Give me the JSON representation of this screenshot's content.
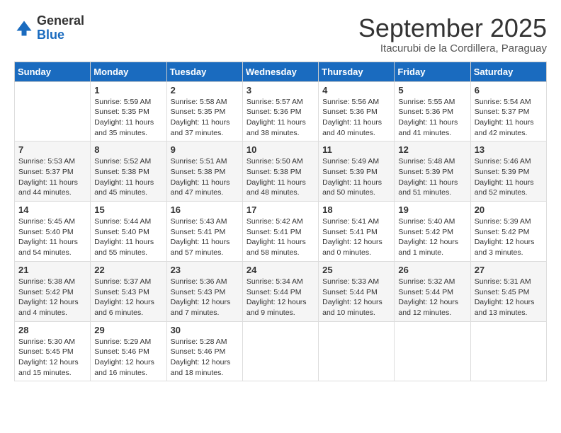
{
  "header": {
    "logo_general": "General",
    "logo_blue": "Blue",
    "month_title": "September 2025",
    "location": "Itacurubi de la Cordillera, Paraguay"
  },
  "days_of_week": [
    "Sunday",
    "Monday",
    "Tuesday",
    "Wednesday",
    "Thursday",
    "Friday",
    "Saturday"
  ],
  "weeks": [
    [
      {
        "day": "",
        "sunrise": "",
        "sunset": "",
        "daylight": ""
      },
      {
        "day": "1",
        "sunrise": "Sunrise: 5:59 AM",
        "sunset": "Sunset: 5:35 PM",
        "daylight": "Daylight: 11 hours and 35 minutes."
      },
      {
        "day": "2",
        "sunrise": "Sunrise: 5:58 AM",
        "sunset": "Sunset: 5:35 PM",
        "daylight": "Daylight: 11 hours and 37 minutes."
      },
      {
        "day": "3",
        "sunrise": "Sunrise: 5:57 AM",
        "sunset": "Sunset: 5:36 PM",
        "daylight": "Daylight: 11 hours and 38 minutes."
      },
      {
        "day": "4",
        "sunrise": "Sunrise: 5:56 AM",
        "sunset": "Sunset: 5:36 PM",
        "daylight": "Daylight: 11 hours and 40 minutes."
      },
      {
        "day": "5",
        "sunrise": "Sunrise: 5:55 AM",
        "sunset": "Sunset: 5:36 PM",
        "daylight": "Daylight: 11 hours and 41 minutes."
      },
      {
        "day": "6",
        "sunrise": "Sunrise: 5:54 AM",
        "sunset": "Sunset: 5:37 PM",
        "daylight": "Daylight: 11 hours and 42 minutes."
      }
    ],
    [
      {
        "day": "7",
        "sunrise": "Sunrise: 5:53 AM",
        "sunset": "Sunset: 5:37 PM",
        "daylight": "Daylight: 11 hours and 44 minutes."
      },
      {
        "day": "8",
        "sunrise": "Sunrise: 5:52 AM",
        "sunset": "Sunset: 5:38 PM",
        "daylight": "Daylight: 11 hours and 45 minutes."
      },
      {
        "day": "9",
        "sunrise": "Sunrise: 5:51 AM",
        "sunset": "Sunset: 5:38 PM",
        "daylight": "Daylight: 11 hours and 47 minutes."
      },
      {
        "day": "10",
        "sunrise": "Sunrise: 5:50 AM",
        "sunset": "Sunset: 5:38 PM",
        "daylight": "Daylight: 11 hours and 48 minutes."
      },
      {
        "day": "11",
        "sunrise": "Sunrise: 5:49 AM",
        "sunset": "Sunset: 5:39 PM",
        "daylight": "Daylight: 11 hours and 50 minutes."
      },
      {
        "day": "12",
        "sunrise": "Sunrise: 5:48 AM",
        "sunset": "Sunset: 5:39 PM",
        "daylight": "Daylight: 11 hours and 51 minutes."
      },
      {
        "day": "13",
        "sunrise": "Sunrise: 5:46 AM",
        "sunset": "Sunset: 5:39 PM",
        "daylight": "Daylight: 11 hours and 52 minutes."
      }
    ],
    [
      {
        "day": "14",
        "sunrise": "Sunrise: 5:45 AM",
        "sunset": "Sunset: 5:40 PM",
        "daylight": "Daylight: 11 hours and 54 minutes."
      },
      {
        "day": "15",
        "sunrise": "Sunrise: 5:44 AM",
        "sunset": "Sunset: 5:40 PM",
        "daylight": "Daylight: 11 hours and 55 minutes."
      },
      {
        "day": "16",
        "sunrise": "Sunrise: 5:43 AM",
        "sunset": "Sunset: 5:41 PM",
        "daylight": "Daylight: 11 hours and 57 minutes."
      },
      {
        "day": "17",
        "sunrise": "Sunrise: 5:42 AM",
        "sunset": "Sunset: 5:41 PM",
        "daylight": "Daylight: 11 hours and 58 minutes."
      },
      {
        "day": "18",
        "sunrise": "Sunrise: 5:41 AM",
        "sunset": "Sunset: 5:41 PM",
        "daylight": "Daylight: 12 hours and 0 minutes."
      },
      {
        "day": "19",
        "sunrise": "Sunrise: 5:40 AM",
        "sunset": "Sunset: 5:42 PM",
        "daylight": "Daylight: 12 hours and 1 minute."
      },
      {
        "day": "20",
        "sunrise": "Sunrise: 5:39 AM",
        "sunset": "Sunset: 5:42 PM",
        "daylight": "Daylight: 12 hours and 3 minutes."
      }
    ],
    [
      {
        "day": "21",
        "sunrise": "Sunrise: 5:38 AM",
        "sunset": "Sunset: 5:42 PM",
        "daylight": "Daylight: 12 hours and 4 minutes."
      },
      {
        "day": "22",
        "sunrise": "Sunrise: 5:37 AM",
        "sunset": "Sunset: 5:43 PM",
        "daylight": "Daylight: 12 hours and 6 minutes."
      },
      {
        "day": "23",
        "sunrise": "Sunrise: 5:36 AM",
        "sunset": "Sunset: 5:43 PM",
        "daylight": "Daylight: 12 hours and 7 minutes."
      },
      {
        "day": "24",
        "sunrise": "Sunrise: 5:34 AM",
        "sunset": "Sunset: 5:44 PM",
        "daylight": "Daylight: 12 hours and 9 minutes."
      },
      {
        "day": "25",
        "sunrise": "Sunrise: 5:33 AM",
        "sunset": "Sunset: 5:44 PM",
        "daylight": "Daylight: 12 hours and 10 minutes."
      },
      {
        "day": "26",
        "sunrise": "Sunrise: 5:32 AM",
        "sunset": "Sunset: 5:44 PM",
        "daylight": "Daylight: 12 hours and 12 minutes."
      },
      {
        "day": "27",
        "sunrise": "Sunrise: 5:31 AM",
        "sunset": "Sunset: 5:45 PM",
        "daylight": "Daylight: 12 hours and 13 minutes."
      }
    ],
    [
      {
        "day": "28",
        "sunrise": "Sunrise: 5:30 AM",
        "sunset": "Sunset: 5:45 PM",
        "daylight": "Daylight: 12 hours and 15 minutes."
      },
      {
        "day": "29",
        "sunrise": "Sunrise: 5:29 AM",
        "sunset": "Sunset: 5:46 PM",
        "daylight": "Daylight: 12 hours and 16 minutes."
      },
      {
        "day": "30",
        "sunrise": "Sunrise: 5:28 AM",
        "sunset": "Sunset: 5:46 PM",
        "daylight": "Daylight: 12 hours and 18 minutes."
      },
      {
        "day": "",
        "sunrise": "",
        "sunset": "",
        "daylight": ""
      },
      {
        "day": "",
        "sunrise": "",
        "sunset": "",
        "daylight": ""
      },
      {
        "day": "",
        "sunrise": "",
        "sunset": "",
        "daylight": ""
      },
      {
        "day": "",
        "sunrise": "",
        "sunset": "",
        "daylight": ""
      }
    ]
  ]
}
